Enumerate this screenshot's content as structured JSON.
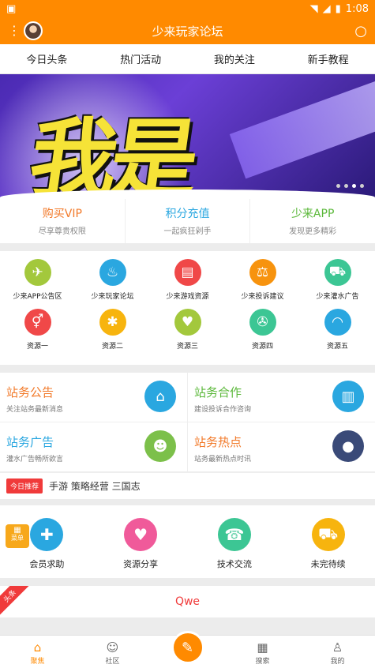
{
  "status": {
    "time": "1:08",
    "icons": [
      "android-icon",
      "wifi-icon",
      "signal-icon",
      "battery-icon"
    ]
  },
  "appbar": {
    "title": "少来玩家论坛"
  },
  "tabs": [
    "今日头条",
    "热门活动",
    "我的关注",
    "新手教程"
  ],
  "banner": {
    "text": "我是"
  },
  "promos": [
    {
      "title": "购买VIP",
      "sub": "尽享尊贵权限",
      "color": "#f27a2a"
    },
    {
      "title": "积分充值",
      "sub": "一起疯狂剁手",
      "color": "#2aa7e0"
    },
    {
      "title": "少来APP",
      "sub": "发现更多精彩",
      "color": "#5bb83a"
    }
  ],
  "grid": [
    [
      {
        "label": "少来APP公告区",
        "color": "#a3c83c",
        "icon": "✈"
      },
      {
        "label": "少来玩家论坛",
        "color": "#2aa7e0",
        "icon": "🔔"
      },
      {
        "label": "少来游戏资源",
        "color": "#f04848",
        "icon": "▤"
      },
      {
        "label": "少来投诉建议",
        "color": "#f7930e",
        "icon": "⚖"
      },
      {
        "label": "少来灌水广告",
        "color": "#3cc694",
        "icon": "🚗"
      }
    ],
    [
      {
        "label": "资源一",
        "color": "#f04848",
        "icon": "⚥"
      },
      {
        "label": "资源二",
        "color": "#f7b40e",
        "icon": "✱"
      },
      {
        "label": "资源三",
        "color": "#a3c83c",
        "icon": "♥"
      },
      {
        "label": "资源四",
        "color": "#3cc694",
        "icon": "✇"
      },
      {
        "label": "资源五",
        "color": "#2aa7e0",
        "icon": "🎧"
      }
    ]
  ],
  "cards": [
    [
      {
        "title": "站务公告",
        "sub": "关注站务最新消息",
        "color": "#f27a2a",
        "art": "#f04848",
        "glyph": "🏪"
      },
      {
        "title": "站务合作",
        "sub": "建设投诉合作咨询",
        "color": "#5bb83a",
        "art": "#2aa7e0",
        "glyph": "🏢"
      }
    ],
    [
      {
        "title": "站务广告",
        "sub": "灌水广告畅所欲言",
        "color": "#2aa7e0",
        "art": "#7cc04a",
        "glyph": "👨"
      },
      {
        "title": "站务热点",
        "sub": "站务最新热点时讯",
        "color": "#f27a2a",
        "art": "#3a4a78",
        "glyph": "💰"
      }
    ]
  ],
  "news": {
    "tag": "今日推荐",
    "text": "手游 策略经营 三国志"
  },
  "menu_badge": {
    "label": "菜单"
  },
  "quick": [
    {
      "label": "会员求助",
      "color": "#2aa7e0",
      "icon": "✚"
    },
    {
      "label": "资源分享",
      "color": "#f05a9a",
      "icon": "♥"
    },
    {
      "label": "技术交流",
      "color": "#3cc694",
      "icon": "☎"
    },
    {
      "label": "未完待续",
      "color": "#f7b40e",
      "icon": "⛟"
    }
  ],
  "headline": {
    "corner": "头条",
    "title": "Qwe"
  },
  "bottomnav": [
    {
      "label": "聚焦",
      "icon": "⌂",
      "active": true
    },
    {
      "label": "社区",
      "icon": "☺",
      "active": false
    },
    {
      "label": "",
      "icon": "✎",
      "fab": true
    },
    {
      "label": "搜索",
      "icon": "▦",
      "active": false
    },
    {
      "label": "我的",
      "icon": "♙",
      "active": false
    }
  ]
}
